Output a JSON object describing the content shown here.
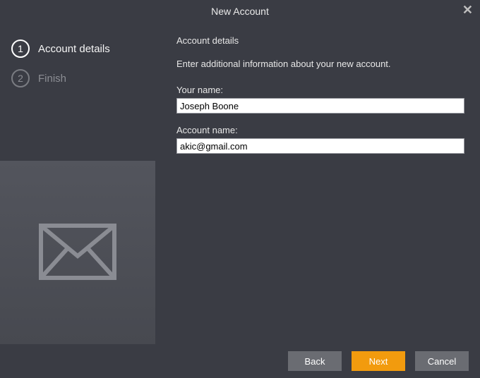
{
  "window": {
    "title": "New Account",
    "close_glyph": "✕"
  },
  "steps": [
    {
      "number": "1",
      "label": "Account details",
      "active": true
    },
    {
      "number": "2",
      "label": "Finish",
      "active": false
    }
  ],
  "content": {
    "heading": "Account details",
    "instruction": "Enter additional information about your new account.",
    "your_name_label": "Your name:",
    "your_name_value": "Joseph Boone",
    "account_name_label": "Account name:",
    "account_name_value": "akic@gmail.com"
  },
  "buttons": {
    "back": "Back",
    "next": "Next",
    "cancel": "Cancel"
  },
  "icons": {
    "sidebar_image": "envelope-icon"
  }
}
